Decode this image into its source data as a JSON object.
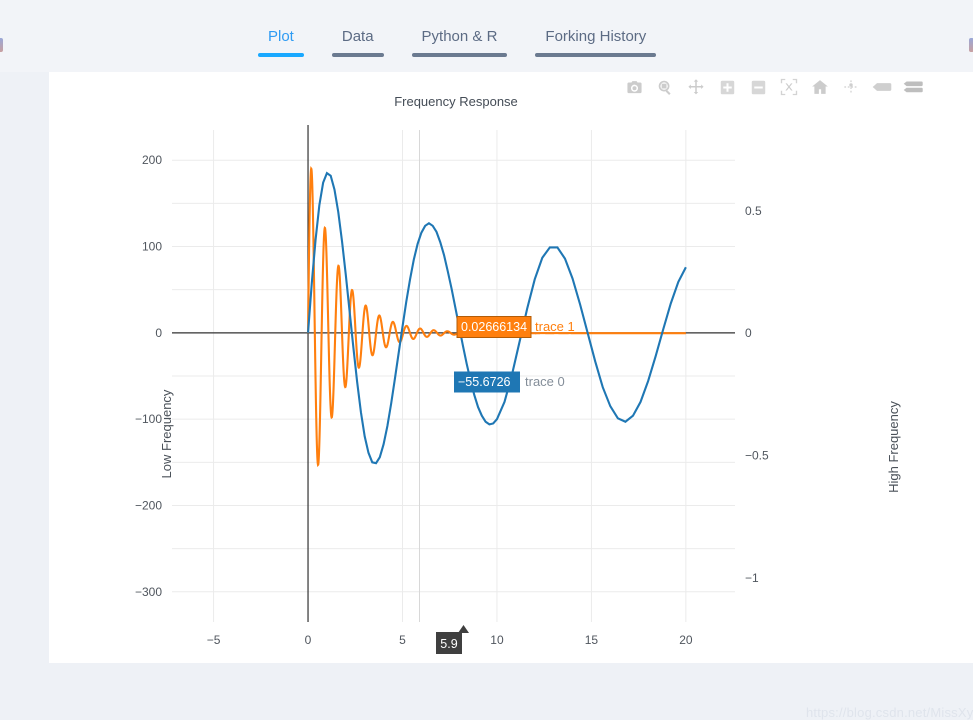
{
  "tabs": [
    {
      "label": "Plot",
      "active": true
    },
    {
      "label": "Data",
      "active": false
    },
    {
      "label": "Python & R",
      "active": false
    },
    {
      "label": "Forking History",
      "active": false
    }
  ],
  "modebar": {
    "buttons": [
      {
        "name": "download-camera-icon",
        "title": "Download plot as a png"
      },
      {
        "name": "zoom-magnifier-icon",
        "title": "Zoom"
      },
      {
        "name": "pan-move-icon",
        "title": "Pan"
      },
      {
        "name": "zoom-in-icon",
        "title": "Zoom in"
      },
      {
        "name": "zoom-out-icon",
        "title": "Zoom out"
      },
      {
        "name": "autoscale-icon",
        "title": "Autoscale"
      },
      {
        "name": "reset-home-icon",
        "title": "Reset axes"
      },
      {
        "name": "toggle-spike-lines-icon",
        "title": "Toggle Spike Lines"
      },
      {
        "name": "show-closest-hover-icon",
        "title": "Show closest data on hover"
      },
      {
        "name": "compare-data-hover-icon",
        "title": "Compare data on hover"
      }
    ]
  },
  "chart_data": {
    "type": "line",
    "title": "Frequency Response",
    "xlabel": "",
    "ylabel": "Low Frequency",
    "y2label": "High Frequency",
    "xlim": [
      -7.2,
      22.6
    ],
    "xticks": [
      -5,
      0,
      5,
      10,
      15,
      20
    ],
    "ylim": [
      -335,
      235
    ],
    "yticks": [
      200,
      100,
      0,
      -100,
      -200,
      -300
    ],
    "y2lim": [
      -1.18,
      0.83
    ],
    "y2ticks": [
      0.5,
      0,
      -0.5,
      -1
    ],
    "grid": true,
    "legend_position": "none",
    "series": [
      {
        "name": "trace 0",
        "axis": "y",
        "color": "#1f77b4",
        "description": "Low-frequency damped sinusoid starting at x=0, period about 6.3, decaying amplitude from 185 to 65",
        "x": [
          0.0,
          0.2,
          0.4,
          0.6,
          0.8,
          1.0,
          1.2,
          1.4,
          1.6,
          1.8,
          2.0,
          2.2,
          2.4,
          2.6,
          2.8,
          3.0,
          3.2,
          3.4,
          3.6,
          3.8,
          4.0,
          4.2,
          4.4,
          4.6,
          4.8,
          5.0,
          5.2,
          5.4,
          5.6,
          5.8,
          6.0,
          6.2,
          6.4,
          6.6,
          6.8,
          7.0,
          7.2,
          7.4,
          7.6,
          7.8,
          8.0,
          8.2,
          8.4,
          8.6,
          8.8,
          9.0,
          9.2,
          9.4,
          9.6,
          9.8,
          10.0,
          10.4,
          10.8,
          11.2,
          11.6,
          12.0,
          12.4,
          12.8,
          13.2,
          13.6,
          14.0,
          14.4,
          14.8,
          15.2,
          15.6,
          16.0,
          16.4,
          16.8,
          17.2,
          17.6,
          18.0,
          18.4,
          18.8,
          19.2,
          19.6,
          20.0
        ],
        "y": [
          0,
          58,
          108,
          148,
          174,
          185,
          182,
          166,
          140,
          106,
          67,
          25,
          -17,
          -57,
          -92,
          -120,
          -139,
          -150,
          -151,
          -144,
          -129,
          -108,
          -82,
          -53,
          -23,
          7,
          36,
          62,
          85,
          103,
          116,
          124,
          127,
          124,
          117,
          105,
          90,
          71,
          51,
          29,
          7,
          -15,
          -36,
          -55,
          -72,
          -86,
          -96,
          -103,
          -106,
          -105,
          -100,
          -80,
          -48,
          -10,
          28,
          62,
          87,
          99,
          99,
          86,
          63,
          33,
          0,
          -33,
          -63,
          -85,
          -99,
          -103,
          -96,
          -80,
          -56,
          -27,
          4,
          34,
          59,
          76
        ]
      },
      {
        "name": "trace 1",
        "axis": "y2",
        "color": "#ff7f0e",
        "description": "High-frequency damped oscillation starting at x=0 with amplitude 0.75 decaying to ~0 by x=9, flat at 0 after",
        "x_start": 0,
        "x_end": 20,
        "amplitude_start": 0.75,
        "decay_rate": 0.62,
        "frequency_period": 0.72
      }
    ],
    "hover_labels": [
      {
        "name": "trace 1",
        "value": "0.02666134",
        "color": "#ff7f0e",
        "text_color": "#ffffff",
        "name_color": "#ff7f0e"
      },
      {
        "name": "trace 0",
        "value": "−55.6726",
        "color": "#1f77b4",
        "text_color": "#ffffff",
        "name_color": "#848e99"
      }
    ],
    "x_hover": {
      "value": "5.9",
      "background": "#3f3f3f",
      "text_color": "#ffffff"
    }
  },
  "watermark": {
    "text": "https://blog.csdn.net/MissXy_"
  }
}
